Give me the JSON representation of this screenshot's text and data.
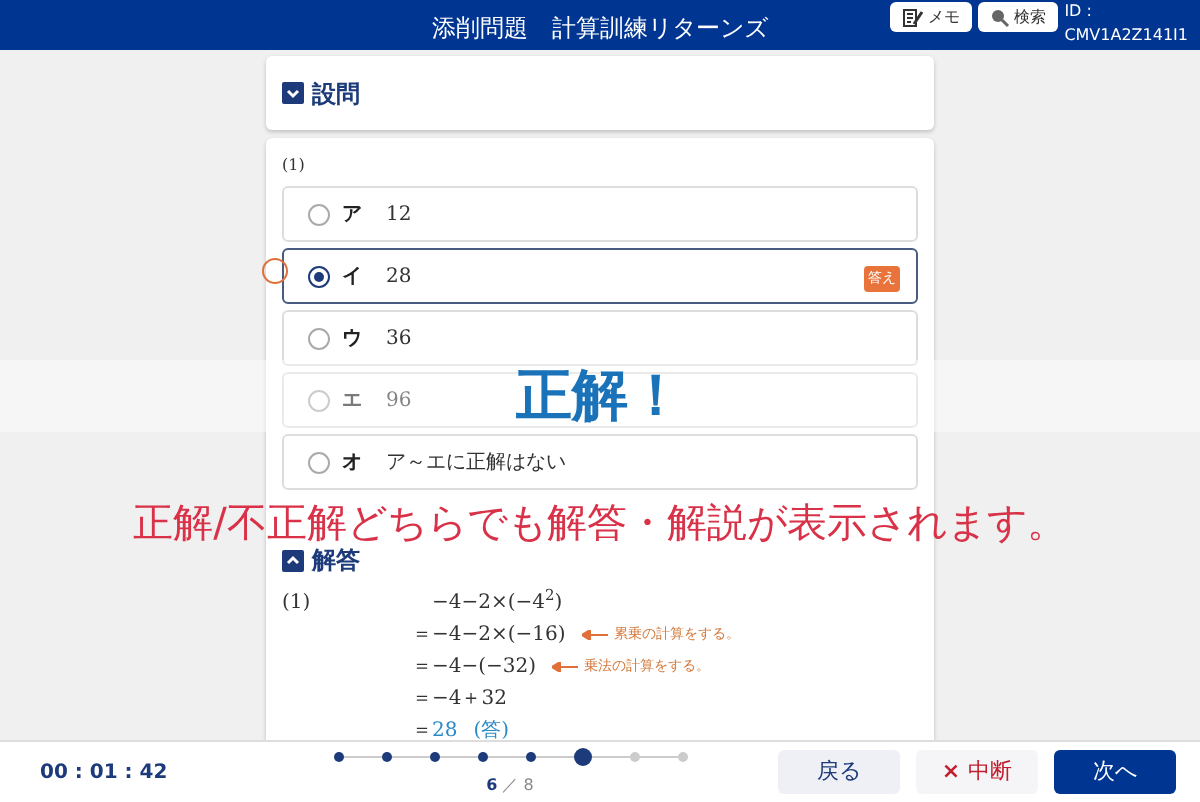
{
  "header": {
    "title": "添削問題　計算訓練リターンズ",
    "memo_button": "メモ",
    "search_button": "検索",
    "id_label": "ID :",
    "id_value": "CMV1A2Z141I1"
  },
  "question_card": {
    "title": "設問",
    "expanded": false
  },
  "question": {
    "number": "(1)",
    "options": [
      {
        "letter": "ア",
        "text": "12",
        "selected": false,
        "correct": false
      },
      {
        "letter": "イ",
        "text": "28",
        "selected": true,
        "correct": true,
        "badge": "答え"
      },
      {
        "letter": "ウ",
        "text": "36",
        "selected": false,
        "correct": false
      },
      {
        "letter": "エ",
        "text": "96",
        "selected": false,
        "correct": false
      },
      {
        "letter": "オ",
        "text": "ア～エに正解はない",
        "selected": false,
        "correct": false
      }
    ]
  },
  "answer": {
    "title": "解答",
    "expanded": true,
    "number": "(1)",
    "lines": [
      {
        "kind": "step",
        "expr": "−4−2×(−4$^{2}$)"
      },
      {
        "kind": "step",
        "expr": "＝−4−2×(−16)",
        "note": "累乗の計算をする。"
      },
      {
        "kind": "step",
        "expr": "＝−4−(−32)",
        "note": "乗法の計算をする。"
      },
      {
        "kind": "step",
        "expr": "＝−4＋32"
      },
      {
        "kind": "answer",
        "expr": "＝",
        "value": "28",
        "mark": "(答)"
      }
    ]
  },
  "result_banner": "正解！",
  "caption": "正解/不正解どちらでも解答・解説が表示されます。",
  "footer": {
    "timer": "00 : 01 : 42",
    "progress": {
      "steps": [
        {
          "filled": true,
          "current": false
        },
        {
          "filled": true,
          "current": false
        },
        {
          "filled": true,
          "current": false
        },
        {
          "filled": true,
          "current": false
        },
        {
          "filled": true,
          "current": false
        },
        {
          "filled": true,
          "current": true
        },
        {
          "filled": false,
          "current": false
        },
        {
          "filled": false,
          "current": false
        }
      ],
      "current": "6",
      "separator": "／",
      "total": "8"
    },
    "back_button": "戻る",
    "suspend_icon": "×",
    "suspend_button": "中断",
    "next_button": "次へ"
  }
}
